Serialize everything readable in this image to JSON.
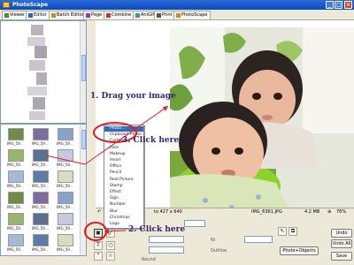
{
  "window": {
    "title": "PhotoScape"
  },
  "tabs": [
    {
      "label": "Viewer",
      "color": "#4a8f2f"
    },
    {
      "label": "Editor",
      "color": "#2f63c9"
    },
    {
      "label": "Batch Editor",
      "color": "#c58a1c"
    },
    {
      "label": "Page",
      "color": "#8a3fb2"
    },
    {
      "label": "Combine",
      "color": "#c23a3a"
    },
    {
      "label": "AniGif",
      "color": "#3a8fb2"
    },
    {
      "label": "Print",
      "color": "#555555"
    },
    {
      "label": "PhotoScape",
      "color": "#d48a1a"
    }
  ],
  "thumbnails": [
    {
      "label": "IMG_59..."
    },
    {
      "label": "IMG_59..."
    },
    {
      "label": "IMG_59..."
    },
    {
      "label": "IMG_59..."
    },
    {
      "label": "IMG_59..."
    },
    {
      "label": "IMG_59..."
    },
    {
      "label": "IMG_59..."
    },
    {
      "label": "IMG_59..."
    },
    {
      "label": "IMG_59..."
    },
    {
      "label": "IMG_59..."
    },
    {
      "label": "IMG_59..."
    },
    {
      "label": "IMG_59..."
    },
    {
      "label": "IMG_59..."
    },
    {
      "label": "IMG_59..."
    },
    {
      "label": "IMG_59..."
    },
    {
      "label": "IMG_59..."
    },
    {
      "label": "IMG_59..."
    },
    {
      "label": "IMG_59..."
    }
  ],
  "menu": {
    "items": [
      "Photo...",
      "Clipboard Photo",
      "Cartoon",
      "Face",
      "Makeup",
      "Heart",
      "Office",
      "Pencil",
      "Real Picture",
      "Stamp",
      "Effect",
      "Sign",
      "Number",
      "Blur",
      "Christmas",
      "Logo"
    ]
  },
  "status": {
    "dimensions": "to 427 x 640",
    "filename": "IMG_6361.JPG",
    "filesize": "4.2 MB",
    "zoom": "76%"
  },
  "tools": {
    "text_tool": "T",
    "quote_tool": "“"
  },
  "controls": {
    "num_label": "Ni",
    "outline_label": "Outline",
    "round_label": "Round",
    "photo_objects_button": "Photo+Objects",
    "undo_button": "Undo",
    "redo_button": "Undo All",
    "save_button": "Save"
  },
  "annotations": {
    "drag": "1. Drag your image",
    "click_menu": "3. Click here",
    "click_button": "2. Click here",
    "accent_color": "#e02020"
  }
}
